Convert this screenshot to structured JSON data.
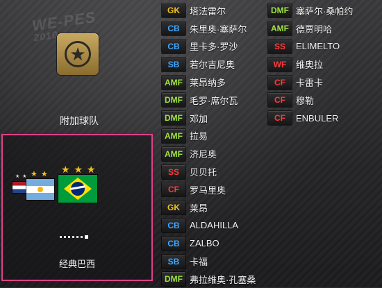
{
  "left_panel": {
    "club_icon": "star-badge-icon",
    "club_label": "附加球队",
    "selected_team": "经典巴西",
    "flags": [
      "netherlands-flag",
      "argentina-flag",
      "brazil-flag"
    ],
    "page_index": 6,
    "page_count": 6
  },
  "colors": {
    "GK": "#f2c21a",
    "CB": "#3fa6ff",
    "SB": "#3fa6ff",
    "AMF": "#9fe23c",
    "DMF": "#9fe23c",
    "SS": "#ff3b3b",
    "WF": "#ff3b3b",
    "CF": "#ff3b3b",
    "highlight": "#e0408a"
  },
  "roster": {
    "col1": [
      {
        "pos": "GK",
        "name": "塔法雷尔"
      },
      {
        "pos": "CB",
        "name": "朱里奥·塞萨尔"
      },
      {
        "pos": "CB",
        "name": "里卡多·罗沙"
      },
      {
        "pos": "SB",
        "name": "若尔吉尼奥"
      },
      {
        "pos": "AMF",
        "name": "莱昂纳多"
      },
      {
        "pos": "DMF",
        "name": "毛罗·席尔瓦"
      },
      {
        "pos": "DMF",
        "name": "邓加"
      },
      {
        "pos": "AMF",
        "name": "拉易"
      },
      {
        "pos": "AMF",
        "name": "济尼奥"
      },
      {
        "pos": "SS",
        "name": "贝贝托"
      },
      {
        "pos": "CF",
        "name": "罗马里奥"
      },
      {
        "pos": "GK",
        "name": "莱昂"
      },
      {
        "pos": "CB",
        "name": "ALDAHILLA"
      },
      {
        "pos": "CB",
        "name": "ZALBO"
      },
      {
        "pos": "SB",
        "name": "卡福"
      },
      {
        "pos": "DMF",
        "name": "弗拉维奥·孔塞桑"
      }
    ],
    "col2": [
      {
        "pos": "DMF",
        "name": "塞萨尔·桑帕约"
      },
      {
        "pos": "AMF",
        "name": "德贾明哈"
      },
      {
        "pos": "SS",
        "name": "ELIMELTO"
      },
      {
        "pos": "WF",
        "name": "维奥拉"
      },
      {
        "pos": "CF",
        "name": "卡雷卡"
      },
      {
        "pos": "CF",
        "name": "穆勒"
      },
      {
        "pos": "CF",
        "name": "ENBULER"
      }
    ]
  }
}
